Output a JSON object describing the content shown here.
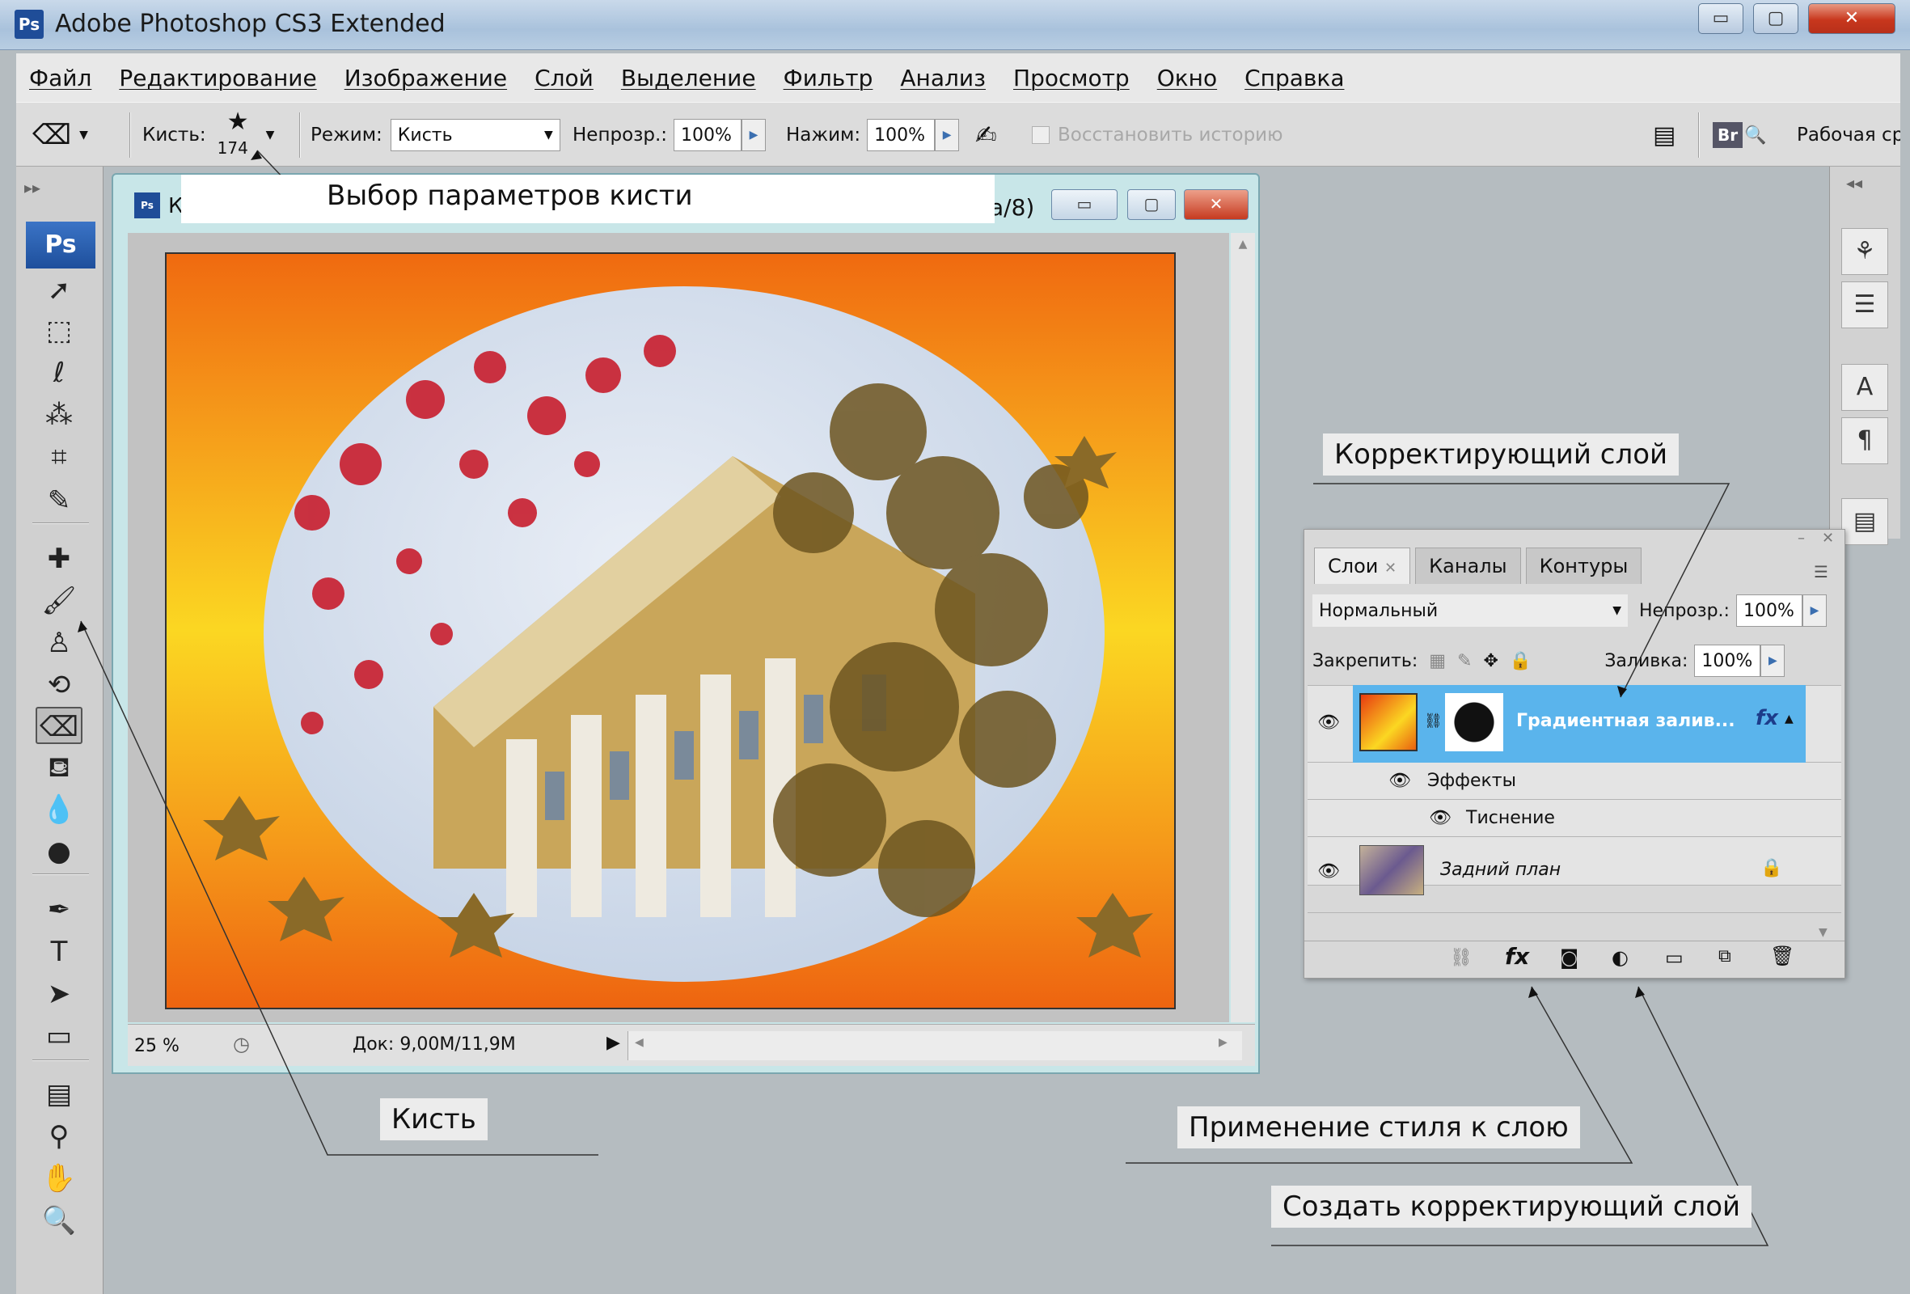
{
  "window": {
    "title": "Adobe Photoshop CS3 Extended",
    "logo": "Ps",
    "minimize": "▭",
    "maximize": "▢",
    "close": "✕"
  },
  "menu": [
    "Файл",
    "Редактирование",
    "Изображение",
    "Слой",
    "Выделение",
    "Фильтр",
    "Анализ",
    "Просмотр",
    "Окно",
    "Справка"
  ],
  "options": {
    "brush_label": "Кисть:",
    "brush_size": "174",
    "mode_label": "Режим:",
    "mode_value": "Кисть",
    "opacity_label": "Непрозр.:",
    "opacity_value": "100%",
    "flow_label": "Нажим:",
    "flow_value": "100%",
    "restore_history": "Восстановить историю",
    "workspace": "Рабочая ср"
  },
  "toolbox": {
    "logo": "Ps",
    "tools": [
      {
        "name": "move-tool-icon",
        "glyph": "➚"
      },
      {
        "name": "marquee-tool-icon",
        "glyph": "⬚"
      },
      {
        "name": "lasso-tool-icon",
        "glyph": "ℓ"
      },
      {
        "name": "magic-wand-tool-icon",
        "glyph": "⁂"
      },
      {
        "name": "crop-tool-icon",
        "glyph": "⌗"
      },
      {
        "name": "slice-tool-icon",
        "glyph": "✎"
      },
      {
        "name": "healing-brush-tool-icon",
        "glyph": "✚"
      },
      {
        "name": "brush-tool-icon",
        "glyph": "🖌"
      },
      {
        "name": "clone-stamp-tool-icon",
        "glyph": "♙"
      },
      {
        "name": "history-brush-tool-icon",
        "glyph": "⟲"
      },
      {
        "name": "eraser-tool-icon",
        "glyph": "⌫"
      },
      {
        "name": "paint-bucket-tool-icon",
        "glyph": "⛾"
      },
      {
        "name": "blur-tool-icon",
        "glyph": "💧"
      },
      {
        "name": "dodge-tool-icon",
        "glyph": "●"
      },
      {
        "name": "pen-tool-icon",
        "glyph": "✒"
      },
      {
        "name": "type-tool-icon",
        "glyph": "T"
      },
      {
        "name": "path-selection-tool-icon",
        "glyph": "➤"
      },
      {
        "name": "shape-tool-icon",
        "glyph": "▭"
      },
      {
        "name": "notes-tool-icon",
        "glyph": "▤"
      },
      {
        "name": "eyedropper-tool-icon",
        "glyph": "⚲"
      },
      {
        "name": "hand-tool-icon",
        "glyph": "✋"
      },
      {
        "name": "zoom-tool-icon",
        "glyph": "🔍"
      }
    ]
  },
  "document": {
    "name_start": "К",
    "name_end": "a/8)",
    "zoom": "25 %",
    "doc_size": "Док: 9,00M/11,9M"
  },
  "layers_panel": {
    "tabs": [
      "Слои",
      "Каналы",
      "Контуры"
    ],
    "blend_mode": "Нормальный",
    "opacity_label": "Непрозр.:",
    "opacity_value": "100%",
    "lock_label": "Закрепить:",
    "fill_label": "Заливка:",
    "fill_value": "100%",
    "layers": [
      {
        "name": "Градиентная залив...",
        "fx": "fx"
      },
      {
        "name": "Эффекты"
      },
      {
        "name": "Тиснение"
      },
      {
        "name": "Задний план"
      }
    ]
  },
  "callouts": {
    "brush_params": "Выбор параметров кисти",
    "brush": "Кисть",
    "adjustment_layer": "Корректирующий слой",
    "apply_style": "Применение стиля к слою",
    "create_adjustment": "Создать корректирующий слой"
  },
  "colors": {
    "layer_selected": "#5ab4ec",
    "gradient_orange": "#f06a10",
    "gradient_yellow": "#fbd722"
  }
}
